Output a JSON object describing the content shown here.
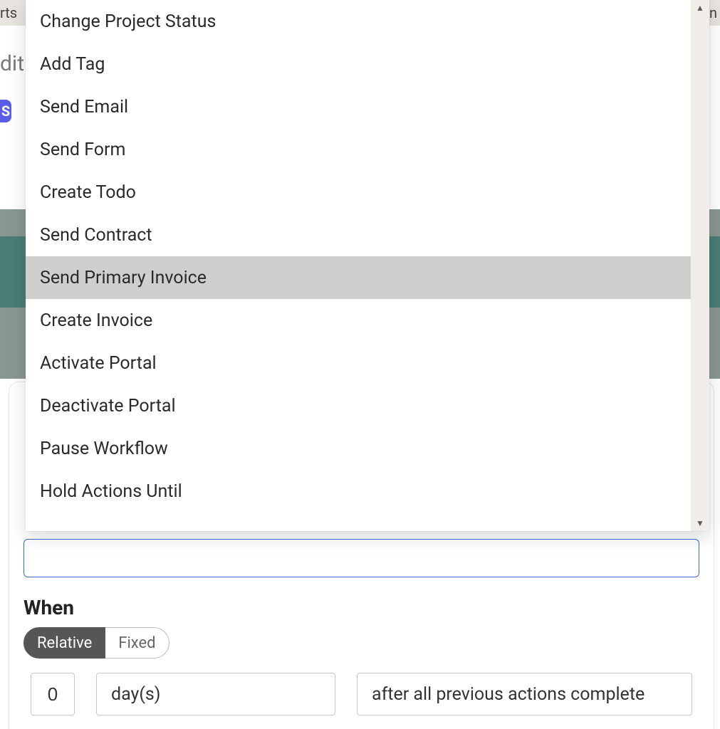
{
  "background": {
    "top_left_text": "rts",
    "top_right_text": "n",
    "edit_text": "dit",
    "badge_text": "S"
  },
  "dropdown": {
    "items": [
      {
        "label": "Change Project Status",
        "highlighted": false
      },
      {
        "label": "Add Tag",
        "highlighted": false
      },
      {
        "label": "Send Email",
        "highlighted": false
      },
      {
        "label": "Send Form",
        "highlighted": false
      },
      {
        "label": "Create Todo",
        "highlighted": false
      },
      {
        "label": "Send Contract",
        "highlighted": false
      },
      {
        "label": "Send Primary Invoice",
        "highlighted": true
      },
      {
        "label": "Create Invoice",
        "highlighted": false
      },
      {
        "label": "Activate Portal",
        "highlighted": false
      },
      {
        "label": "Deactivate Portal",
        "highlighted": false
      },
      {
        "label": "Pause Workflow",
        "highlighted": false
      },
      {
        "label": "Hold Actions Until",
        "highlighted": false
      }
    ]
  },
  "form": {
    "when_label": "When",
    "toggle": {
      "relative": "Relative",
      "fixed": "Fixed",
      "active": "relative"
    },
    "offset_value": "0",
    "unit_label": "day(s)",
    "trigger_label": "after all previous actions complete"
  }
}
